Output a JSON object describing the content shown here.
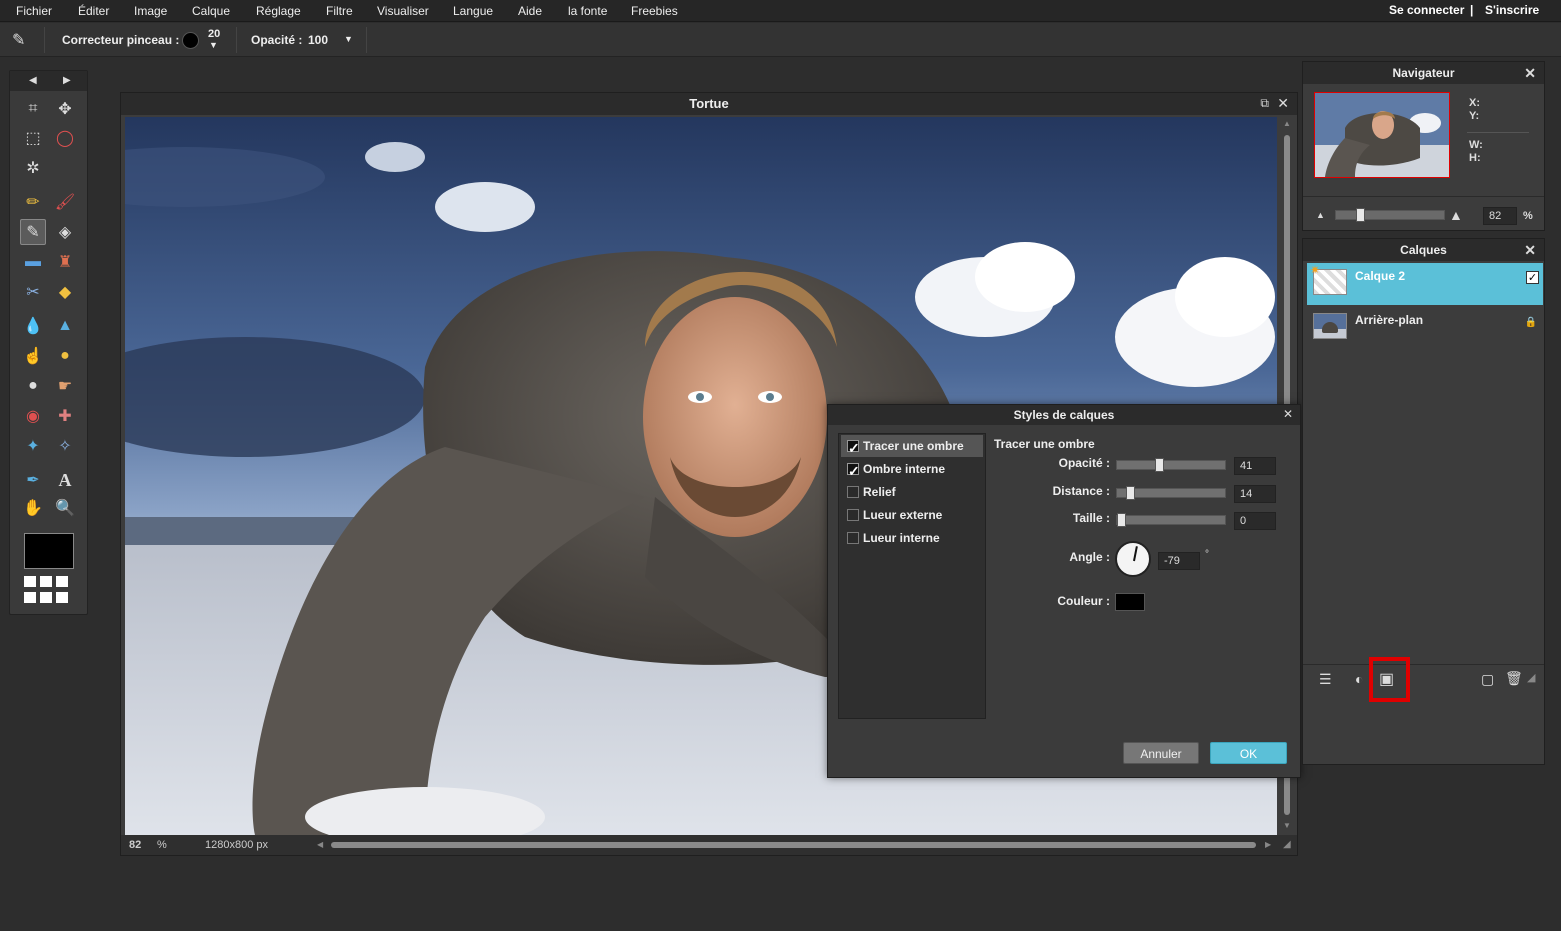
{
  "menu": {
    "items": [
      "Fichier",
      "Éditer",
      "Image",
      "Calque",
      "Réglage",
      "Filtre",
      "Visualiser",
      "Langue",
      "Aide",
      "la fonte",
      "Freebies"
    ],
    "login": "Se connecter",
    "divider": "|",
    "signup": "S'inscrire"
  },
  "options": {
    "brush_label": "Correcteur pinceau :",
    "brush_size": "20",
    "opacity_label": "Opacité :",
    "opacity_value": "100"
  },
  "document": {
    "title": "Tortue",
    "zoom": "82",
    "zoom_unit": "%",
    "dimensions": "1280x800 px"
  },
  "dialog": {
    "title": "Styles de calques",
    "styles": [
      {
        "label": "Tracer une ombre",
        "checked": true
      },
      {
        "label": "Ombre interne",
        "checked": true
      },
      {
        "label": "Relief",
        "checked": false
      },
      {
        "label": "Lueur externe",
        "checked": false
      },
      {
        "label": "Lueur interne",
        "checked": false
      }
    ],
    "section_title": "Tracer une ombre",
    "opacity_label": "Opacité :",
    "opacity_value": "41",
    "distance_label": "Distance :",
    "distance_value": "14",
    "size_label": "Taille :",
    "size_value": "0",
    "angle_label": "Angle :",
    "angle_value": "-79",
    "angle_unit": "°",
    "color_label": "Couleur :",
    "shadow_color": "#000000",
    "cancel_label": "Annuler",
    "ok_label": "OK"
  },
  "navigator": {
    "title": "Navigateur",
    "x_label": "X:",
    "y_label": "Y:",
    "w_label": "W:",
    "h_label": "H:",
    "zoom_value": "82",
    "zoom_unit": "%"
  },
  "layers": {
    "title": "Calques",
    "items": [
      {
        "name": "Calque 2",
        "selected": true
      },
      {
        "name": "Arrière-plan",
        "selected": false
      }
    ]
  },
  "colors": {
    "accent": "#5bc0d8",
    "highlight": "#e00000"
  }
}
